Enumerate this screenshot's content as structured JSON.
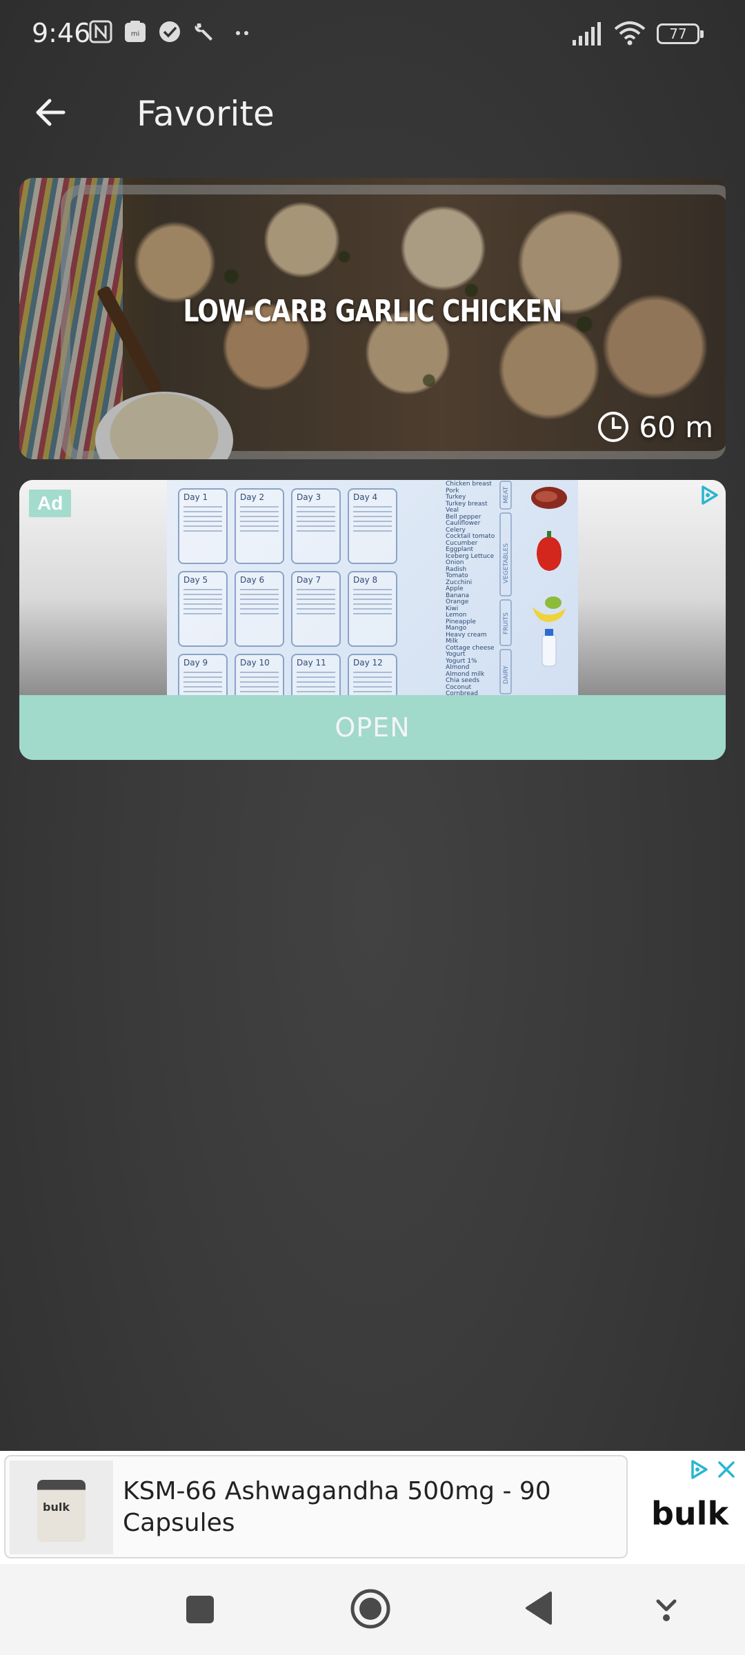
{
  "status_bar": {
    "time": "9:46",
    "battery": "77"
  },
  "header": {
    "title": "Favorite"
  },
  "recipe": {
    "title": "LOW-CARB GARLIC CHICKEN",
    "time": "60 m"
  },
  "ad_card": {
    "badge": "Ad",
    "cta": "OPEN",
    "days": [
      "Day 1",
      "Day 2",
      "Day 3",
      "Day 4",
      "Day 5",
      "Day 6",
      "Day 7",
      "Day 8",
      "Day 9",
      "Day 10",
      "Day 11",
      "Day 12"
    ],
    "grocery_groups": [
      {
        "label": "MEAT",
        "items": [
          "Chicken breast",
          "Pork",
          "Turkey",
          "Turkey breast",
          "Veal"
        ]
      },
      {
        "label": "VEGETABLES",
        "items": [
          "Bell pepper",
          "Cauliflower",
          "Celery",
          "Cocktail tomato",
          "Cucumber",
          "Eggplant",
          "Iceberg Lettuce",
          "Onion",
          "Radish",
          "Tomato",
          "Zucchini"
        ]
      },
      {
        "label": "FRUITS",
        "items": [
          "Apple",
          "Banana",
          "Orange",
          "Kiwi",
          "Lemon",
          "Pineapple",
          "Mango"
        ]
      },
      {
        "label": "DAIRY",
        "items": [
          "Heavy cream",
          "Milk",
          "Cottage cheese",
          "Yogurt",
          "Yogurt 1%",
          "Almond",
          "Almond milk",
          "Chia seeds",
          "Coconut",
          "Cornbread"
        ]
      }
    ]
  },
  "banner_ad": {
    "text": "KSM-66 Ashwagandha 500mg - 90 Capsules",
    "brand": "bulk",
    "product_label": "bulk"
  },
  "colors": {
    "accent": "#a1d9cb",
    "ad_choices": "#29b6d1",
    "background": "#3a3a3a"
  }
}
